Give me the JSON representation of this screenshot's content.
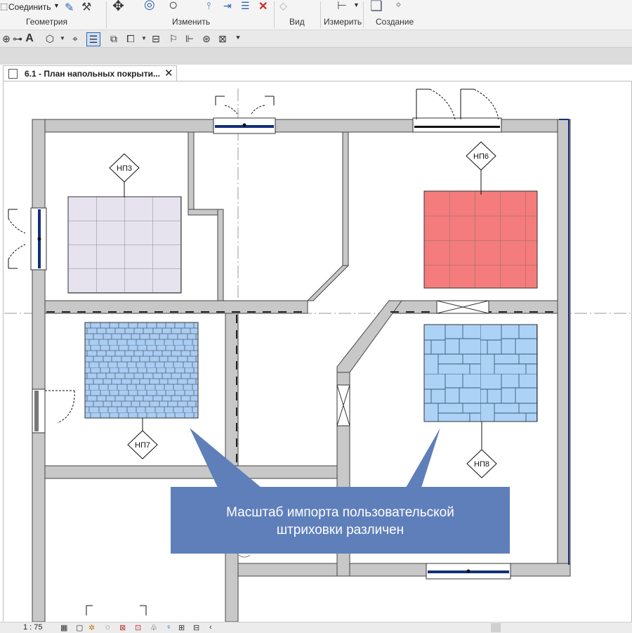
{
  "ribbon": {
    "join_label": "Соединить",
    "panels": [
      {
        "label": "Геометрия"
      },
      {
        "label": "Изменить"
      },
      {
        "label": "Вид"
      },
      {
        "label": "Измерить"
      },
      {
        "label": "Создание"
      }
    ]
  },
  "tab": {
    "title": "6.1 - План напольных покрыти..."
  },
  "tags": [
    {
      "label": "НП3"
    },
    {
      "label": "НП6"
    },
    {
      "label": "НП7"
    },
    {
      "label": "НП8"
    }
  ],
  "hatch_colors": {
    "np3": "#e6e3ee",
    "np6": "#f47c7c",
    "np7": "#a9cdf3",
    "np8": "#acd2f6"
  },
  "callout": {
    "line1": "Масштаб импорта пользовательской",
    "line2": "штриховки различен"
  },
  "status": {
    "scale": "1 : 75"
  }
}
